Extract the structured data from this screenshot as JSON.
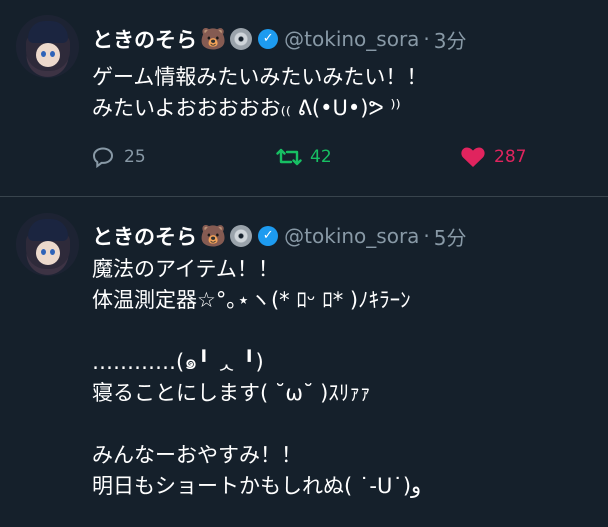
{
  "tweets": [
    {
      "name": "ときのそら",
      "name_emoji": "🐻",
      "handle": "@tokino_sora",
      "separator": "·",
      "time": "3分",
      "lines": [
        "ゲーム情報みたいみたいみたい！！",
        "みたいよおおおおお₍₍ ᕕ(•ᑌ•)ᕗ ⁾⁾"
      ],
      "stats": {
        "replies": "25",
        "retweets": "42",
        "likes": "287"
      }
    },
    {
      "name": "ときのそら",
      "name_emoji": "🐻",
      "handle": "@tokino_sora",
      "separator": "·",
      "time": "5分",
      "lines": [
        "魔法のアイテム！！",
        "体温測定器☆°｡⋆ヽ(* ﾛᵕ ﾛ* )ﾉｷﾗｰﾝ",
        "",
        "…………(๑╹ ᆺ ╹)",
        "寝ることにします( ˘ω˘ )ｽﾘｧｧ",
        "",
        "みんなーおやすみ！！",
        "明日もショートかもしれぬ( ˙-ᑌ˙)و"
      ]
    }
  ],
  "colors": {
    "background": "#15202b",
    "divider": "#38444d",
    "secondary_text": "#8899a6",
    "retweet": "#17bf63",
    "like": "#e0245e",
    "verified": "#1d9bf0"
  }
}
